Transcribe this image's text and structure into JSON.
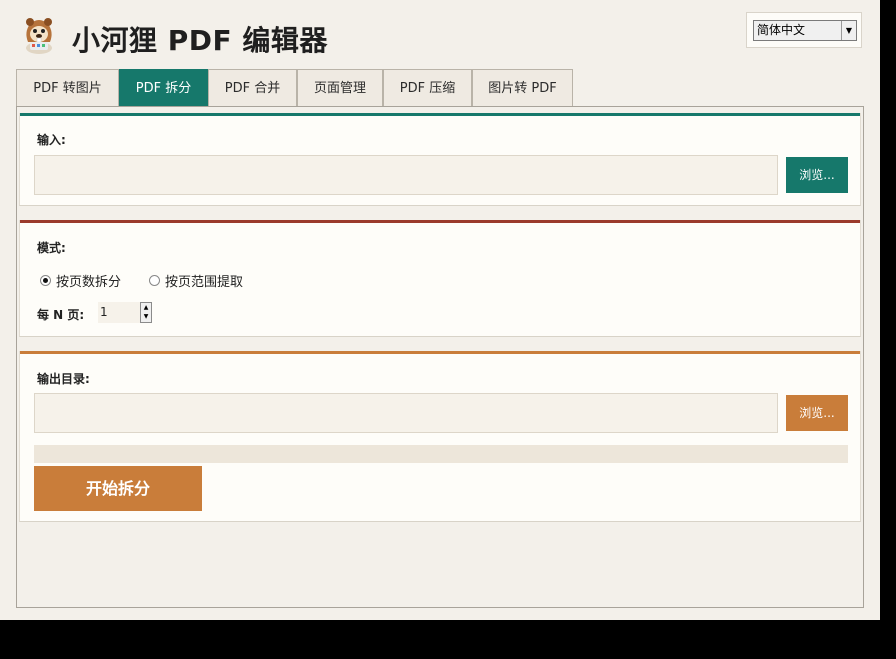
{
  "app": {
    "title": "小河狸 PDF 编辑器",
    "language": "简体中文"
  },
  "tabs": [
    {
      "label": "PDF 转图片",
      "active": false
    },
    {
      "label": "PDF 拆分",
      "active": true
    },
    {
      "label": "PDF 合并",
      "active": false
    },
    {
      "label": "页面管理",
      "active": false
    },
    {
      "label": "PDF 压缩",
      "active": false
    },
    {
      "label": "图片转 PDF",
      "active": false
    }
  ],
  "input_section": {
    "label": "输入:",
    "value": "",
    "browse_label": "浏览..."
  },
  "mode_section": {
    "label": "模式:",
    "options": [
      {
        "label": "按页数拆分",
        "selected": true
      },
      {
        "label": "按页范围提取",
        "selected": false
      }
    ],
    "pages_label": "每 N 页:",
    "pages_value": "1"
  },
  "output_section": {
    "label": "输出目录:",
    "value": "",
    "browse_label": "浏览...",
    "progress": 0,
    "start_label": "开始拆分"
  },
  "colors": {
    "teal": "#16786b",
    "brown_red": "#9b3a2c",
    "orange": "#c97d3a"
  },
  "icons": {
    "logo": "beaver-logo-icon",
    "dropdown": "chevron-down-icon",
    "spinner_up": "arrow-up-icon",
    "spinner_down": "arrow-down-icon"
  }
}
